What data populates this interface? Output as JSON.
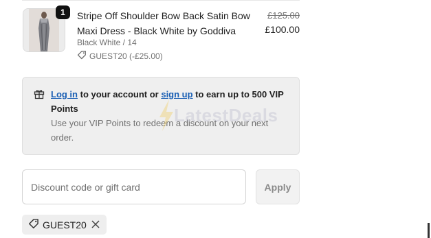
{
  "line_item": {
    "quantity": "1",
    "product_name": "Stripe Off Shoulder Bow Back Satin Bow Maxi Dress - Black White by Goddiva",
    "variant": "Black White / 14",
    "discount_applied": "GUEST20 (-£25.00)",
    "original_price": "£125.00",
    "sale_price": "£100.00"
  },
  "vip_banner": {
    "login_link": "Log in",
    "middle_text": " to your account or ",
    "signup_link": "sign up",
    "earn_text": " to earn up to 500 VIP Points",
    "subtext": "Use your VIP Points to redeem a discount on your next order.",
    "watermark": "LatestDeals"
  },
  "discount_form": {
    "placeholder": "Discount code or gift card",
    "apply_label": "Apply"
  },
  "applied_code": {
    "code": "GUEST20"
  },
  "colors": {
    "link": "#1a5fb4",
    "panel_bg": "#efefef"
  }
}
